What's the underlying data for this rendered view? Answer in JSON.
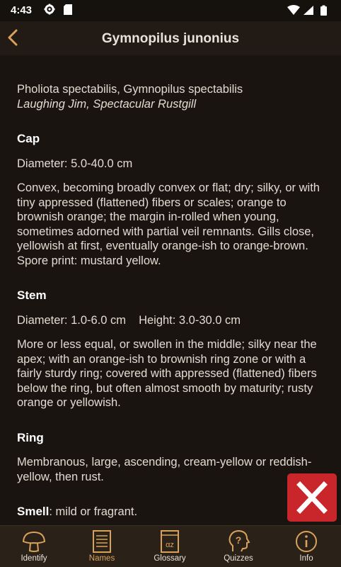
{
  "status": {
    "time": "4:43"
  },
  "header": {
    "title": "Gymnopilus junonius"
  },
  "names": {
    "scientific": "Pholiota spectabilis, Gymnopilus spectabilis",
    "common": "Laughing Jim, Spectacular Rustgill"
  },
  "cap": {
    "heading": "Cap",
    "diameter": "Diameter: 5.0-40.0 cm",
    "description": "Convex, becoming broadly convex or flat; dry; silky, or with tiny appressed (flattened) fibers or scales; orange to brownish orange; the margin in-rolled when young, sometimes adorned with partial veil remnants. Gills close, yellowish at first, eventually orange-ish to orange-brown. Spore print: mustard yellow."
  },
  "stem": {
    "heading": "Stem",
    "diameter": "Diameter: 1.0-6.0 cm",
    "height": "Height: 3.0-30.0 cm",
    "description": "More or less equal, or swollen in the middle; silky near the apex; with an orange-ish to brownish ring zone or with a fairly sturdy ring; covered with appressed (flattened) fibers below the ring, but often almost smooth by maturity; rusty orange or yellowish."
  },
  "ring": {
    "heading": "Ring",
    "description": "Membranous, large, ascending, cream-yellow or reddish-yellow, then rust."
  },
  "smell": {
    "heading": "Smell",
    "value": ": mild or fragrant."
  },
  "bottom_nav": {
    "identify": "Identify",
    "names": "Names",
    "glossary": "Glossary",
    "quizzes": "Quizzes",
    "info": "Info"
  },
  "colors": {
    "accent": "#d8a25b",
    "background": "#1a1410",
    "close_button": "#c8262b"
  }
}
